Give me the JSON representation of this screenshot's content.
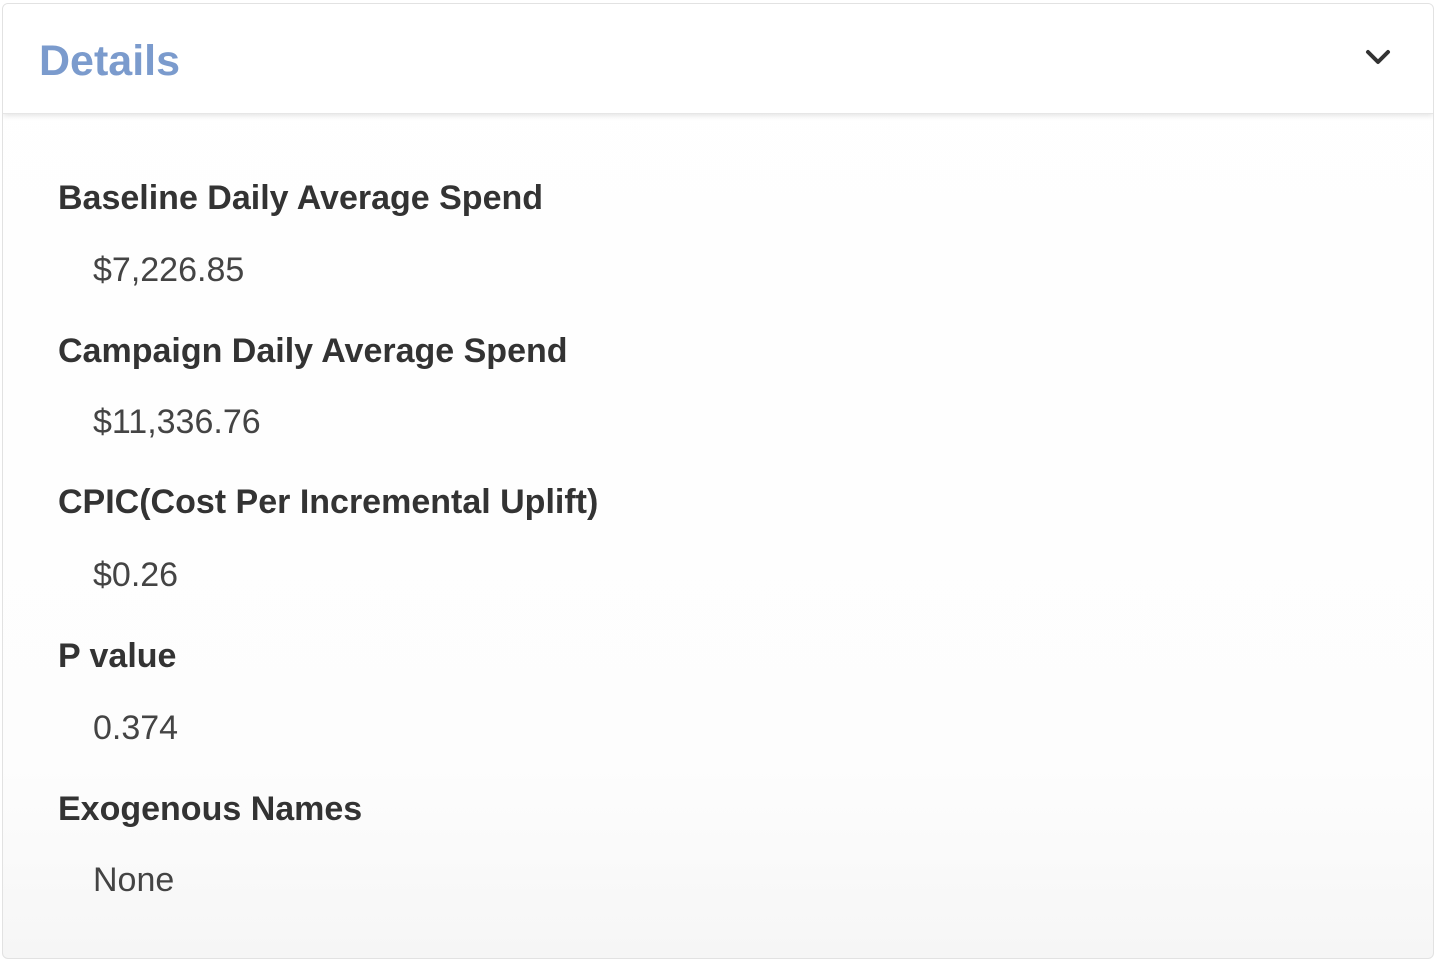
{
  "panel": {
    "title": "Details",
    "title_color": "#7b9bcd",
    "toggle_icon": "chevron-down-icon"
  },
  "fields": [
    {
      "label": "Baseline Daily Average Spend",
      "value": "$7,226.85"
    },
    {
      "label": "Campaign Daily Average Spend",
      "value": "$11,336.76"
    },
    {
      "label": "CPIC(Cost Per Incremental Uplift)",
      "value": "$0.26"
    },
    {
      "label": "P value",
      "value": "0.374"
    },
    {
      "label": "Exogenous Names",
      "value": "None"
    }
  ]
}
